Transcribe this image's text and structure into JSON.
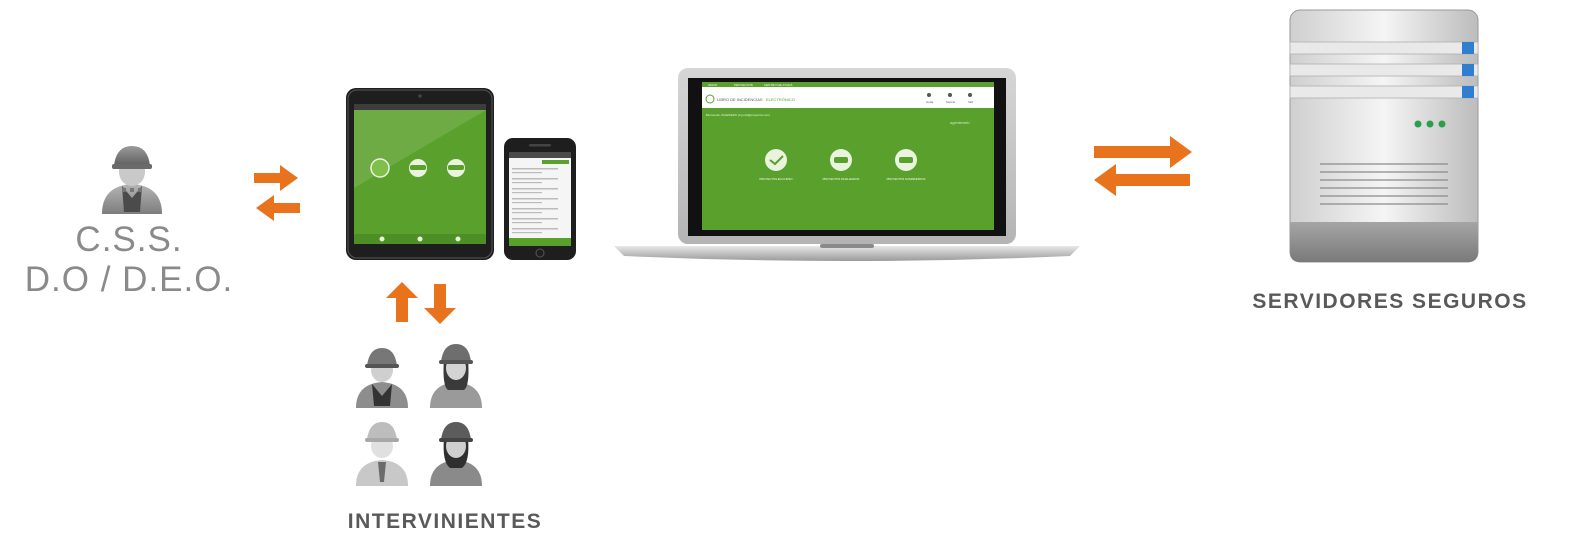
{
  "supervisor": {
    "line1": "C.S.S.",
    "line2": "D.O / D.E.O."
  },
  "participants": {
    "label": "INTERVINIENTES"
  },
  "servers": {
    "label": "SERVIDORES SEGUROS"
  },
  "laptop_screen": {
    "nav": [
      "INICIO",
      "PROYECTOS",
      "CENTRO DE AYUDA"
    ],
    "app_title": "LIBRO DE INCIDENCIAS",
    "app_title_accent": "ELECTRÓNICO",
    "toolbar": [
      "Ayuda",
      "Soporte",
      "Salir"
    ],
    "welcome": "Bienvenido, INGENIERO (ing.soft@proyectos.com)",
    "brand": "agenteweb",
    "projects": [
      "PROYECTOS EN CURSO",
      "PROYECTOS FINALIZADOS",
      "PROYECTOS SUSPENDIDOS"
    ]
  },
  "colors": {
    "arrow": "#e8731c",
    "app_green": "#5aa02c",
    "label_gray": "#8a8a8a",
    "label_dark": "#595959"
  }
}
